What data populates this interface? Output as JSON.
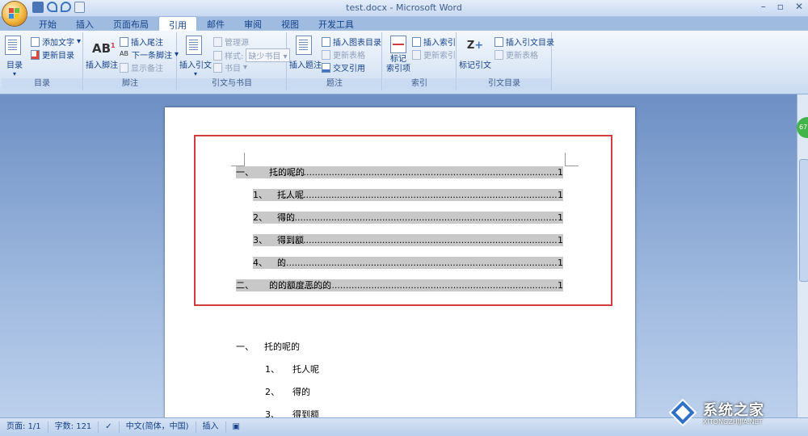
{
  "window": {
    "title": "test.docx - Microsoft Word",
    "minimize": "–",
    "restore": "▫",
    "close": "✕"
  },
  "tabs": [
    "开始",
    "插入",
    "页面布局",
    "引用",
    "邮件",
    "审阅",
    "视图",
    "开发工具"
  ],
  "active_tab": "引用",
  "ribbon": {
    "toc_group": {
      "label": "目录",
      "toc_button": "目录",
      "add_text": "添加文字",
      "update_toc": "更新目录"
    },
    "footnote_group": {
      "label": "脚注",
      "insert_footnote": "插入脚注",
      "insert_endnote": "插入尾注",
      "next_footnote": "下一条脚注",
      "show_notes": "显示备注"
    },
    "citation_group": {
      "label": "引文与书目",
      "insert_citation": "插入引文",
      "manage_sources": "管理源",
      "style_label": "样式:",
      "style_value": "缺少书目",
      "bibliography": "书目"
    },
    "caption_group": {
      "label": "题注",
      "insert_caption": "插入题注",
      "insert_table_of_figures": "插入图表目录",
      "update_table": "更新表格",
      "cross_reference": "交叉引用"
    },
    "index_group": {
      "label": "索引",
      "mark_entry": "标记\n索引项",
      "insert_index": "插入索引",
      "update_index": "更新索引"
    },
    "authorities_group": {
      "label": "引文目录",
      "mark_citation": "标记引文",
      "insert_toa": "插入引文目录",
      "update_table": "更新表格"
    }
  },
  "toc": [
    {
      "num": "一、",
      "text": "托的呢的",
      "page": "1",
      "level": 1
    },
    {
      "num": "1、",
      "text": "托人呢",
      "page": "1",
      "level": 2
    },
    {
      "num": "2、",
      "text": "得的",
      "page": "1",
      "level": 2
    },
    {
      "num": "3、",
      "text": "得到额",
      "page": "1",
      "level": 2
    },
    {
      "num": "4、",
      "text": "的",
      "page": "1",
      "level": 2
    },
    {
      "num": "二、",
      "text": "的的额度恶的的",
      "page": "1",
      "level": 1
    }
  ],
  "body": [
    {
      "num": "一、",
      "text": "托的呢的",
      "level": 1
    },
    {
      "num": "1、",
      "text": "托人呢",
      "level": 2
    },
    {
      "num": "2、",
      "text": "得的",
      "level": 2
    },
    {
      "num": "3、",
      "text": "得到额",
      "level": 2
    }
  ],
  "status": {
    "page": "页面: 1/1",
    "words": "字数: 121",
    "language": "中文(简体，中国)",
    "mode": "插入"
  },
  "zoom_badge": "67",
  "watermark": {
    "text": "系统之家",
    "url": "XITONGZHIJIA.NET"
  },
  "colors": {
    "accent": "#15428b",
    "red_box": "#d23c3c",
    "toc_shade": "#c8c8c8"
  }
}
